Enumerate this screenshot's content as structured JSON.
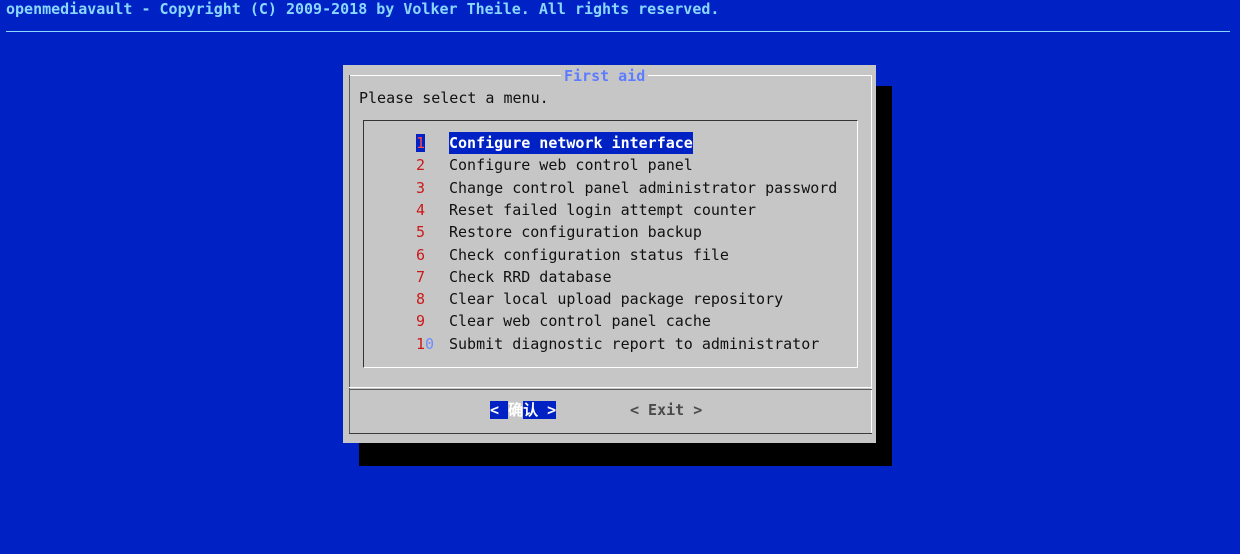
{
  "backtitle": "openmediavault - Copyright (C) 2009-2018 by Volker Theile. All rights reserved.",
  "dialog": {
    "title": "First aid",
    "prompt": "Please select a menu.",
    "selected_index": 0,
    "items": [
      {
        "tag": "1",
        "label": "Configure network interface"
      },
      {
        "tag": "2",
        "label": "Configure web control panel"
      },
      {
        "tag": "3",
        "label": "Change control panel administrator password"
      },
      {
        "tag": "4",
        "label": "Reset failed login attempt counter"
      },
      {
        "tag": "5",
        "label": "Restore configuration backup"
      },
      {
        "tag": "6",
        "label": "Check configuration status file"
      },
      {
        "tag": "7",
        "label": "Check RRD database"
      },
      {
        "tag": "8",
        "label": "Clear local upload package repository"
      },
      {
        "tag": "9",
        "label": "Clear web control panel cache"
      },
      {
        "tag": "10",
        "label": "Submit diagnostic report to administrator"
      }
    ],
    "buttons": {
      "ok_open": "<",
      "ok_hot": "确",
      "ok_rest": "认",
      "ok_close": ">",
      "exit": "< Exit >"
    }
  },
  "colors": {
    "background": "#0022c4",
    "dialog": "#c6c6c6",
    "title": "#5e7cff",
    "tag": "#cc1818"
  }
}
